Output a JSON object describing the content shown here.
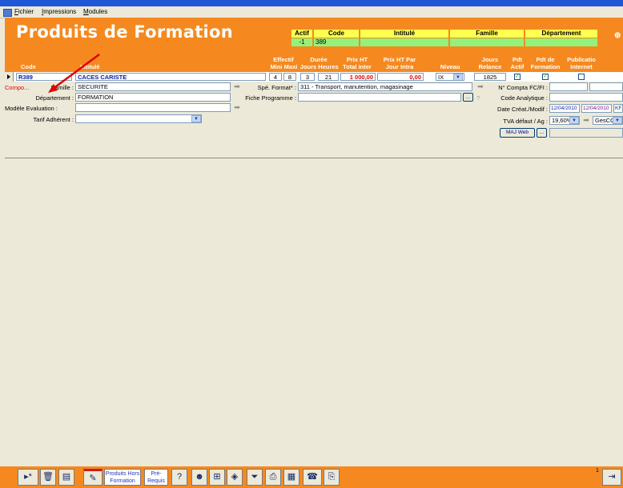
{
  "menu": {
    "items": [
      "Fichier",
      "Impressions",
      "Modules"
    ]
  },
  "page": {
    "title": "Produits de Formation"
  },
  "filters": {
    "headers": [
      "Actif",
      "Code",
      "Intitulé",
      "Famille",
      "Département"
    ],
    "values": {
      "actif": "-1",
      "code": "389",
      "intitule": "",
      "famille": "",
      "departement": ""
    }
  },
  "columns": {
    "code": "Code",
    "intitule": "Intitulé",
    "effectif": "Effectif",
    "mini": "Mini",
    "maxi": "Maxi",
    "duree": "Durée",
    "jours": "Jours",
    "heures": "Heures",
    "prix_ht_total_1": "Prix HT",
    "prix_ht_total_2": "Total Inter",
    "prix_ht_jour_1": "Prix HT Par",
    "prix_ht_jour_2": "Jour Intra",
    "niveau": "Niveau",
    "jours_relance_1": "Jours",
    "jours_relance_2": "Relance",
    "pdt_actif_1": "Pdt",
    "pdt_actif_2": "Actif",
    "pdt_formation_1": "Pdt de",
    "pdt_formation_2": "Formation",
    "publication_1": "Publicatio",
    "publication_2": "Internet"
  },
  "record": {
    "code": "R389",
    "intitule": "CACES CARISTE",
    "mini": "4",
    "maxi": "8",
    "jours": "3",
    "heures": "21",
    "prix_total": "1 000,00",
    "prix_jour": "0,00",
    "niveau": "IX",
    "jours_relance": "1825",
    "pdt_actif": true,
    "pdt_formation": true,
    "publication": false
  },
  "detail": {
    "compo": "Compo...",
    "famille_label": "Famille :",
    "famille_value": "SECURITE",
    "departement_label": "Département :",
    "departement_value": "FORMATION",
    "modele_label": "Modèle Evaluation :",
    "modele_value": "",
    "tarif_label": "Tarif Adhérent :",
    "tarif_value": "",
    "spe_label": "Spé. Format* :",
    "spe_value": "311 - Transport, manutention, magasinage",
    "fiche_label": "Fiche Programme :",
    "fiche_value": "",
    "ncompta_label": "N° Compta FC/FI :",
    "code_analytique_label": "Code Analytique :",
    "date_label": "Date Créat./Modif :",
    "date_creat": "12/04/2010",
    "date_modif": "12/04/2010",
    "date_user": "KF",
    "tva_label": "TVA défaut / Ag :",
    "tva_value": "19,60%",
    "ag_value": "GesCO",
    "maj_web": "MAJ Web",
    "ellipsis": "...",
    "question": "?"
  },
  "toolbar": {
    "produits_hors_1": "Produits Hors",
    "produits_hors_2": "Formation",
    "prerequis_1": "Pré-",
    "prerequis_2": "Requis",
    "record_count": "1"
  },
  "colors": {
    "header_orange": "#f5891f",
    "filter_yellow": "#ffff4f",
    "filter_green": "#93f27a",
    "value_blue": "#0a1fa8",
    "price_red": "#e00000"
  }
}
